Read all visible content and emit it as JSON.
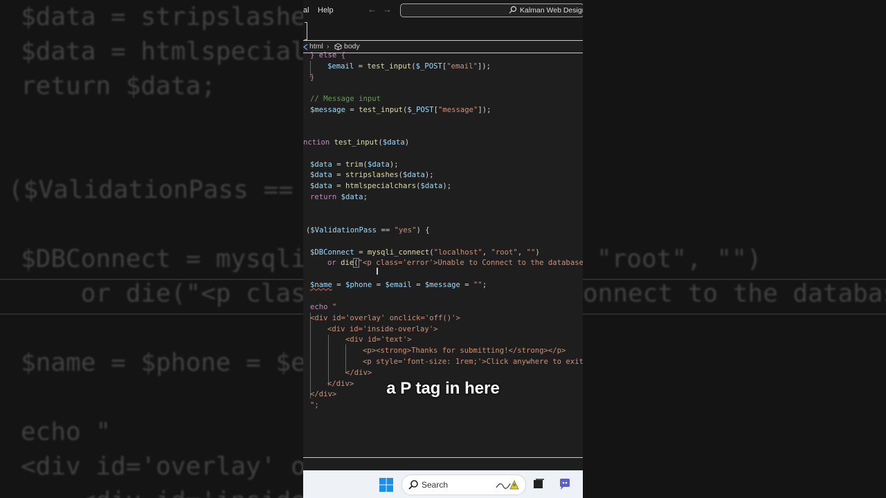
{
  "menu": {
    "partial_item": "al",
    "help": "Help"
  },
  "command_center": {
    "text": "Kalman Web Design I"
  },
  "breadcrumb": {
    "html": "html",
    "body": "body"
  },
  "code_lines": {
    "l1": "} else {",
    "l2a": "$email",
    "l2b": " = ",
    "l2c": "test_input",
    "l2d": "(",
    "l2e": "$_POST",
    "l2f": "[",
    "l2g": "\"email\"",
    "l2h": "]);",
    "l3": "}",
    "l4": "// Message input",
    "l5a": "$message",
    "l5b": " = ",
    "l5c": "test_input",
    "l5d": "(",
    "l5e": "$_POST",
    "l5f": "[",
    "l5g": "\"message\"",
    "l5h": "]);",
    "l6a": "nction",
    "l6b": " test_input",
    "l6c": "(",
    "l6d": "$data",
    "l6e": ")",
    "l7a": "$data",
    "l7b": " = ",
    "l7c": "trim",
    "l7d": "(",
    "l7e": "$data",
    "l7f": ");",
    "l8a": "$data",
    "l8b": " = ",
    "l8c": "stripslashes",
    "l8d": "(",
    "l8e": "$data",
    "l8f": ");",
    "l9a": "$data",
    "l9b": " = ",
    "l9c": "htmlspecialchars",
    "l9d": "(",
    "l9e": "$data",
    "l9f": ");",
    "l10a": "return",
    "l10b": " $data",
    "l10c": ";",
    "l11a": "(",
    "l11b": "$ValidationPass",
    "l11c": " == ",
    "l11d": "\"yes\"",
    "l11e": ") {",
    "l12a": "$DBConnect",
    "l12b": " = ",
    "l12c": "mysqli_connect",
    "l12d": "(",
    "l12e": "\"localhost\"",
    "l12f": ", ",
    "l12g": "\"root\"",
    "l12h": ", ",
    "l12i": "\"\"",
    "l12j": ")",
    "l13a": "or",
    "l13b": " die",
    "l13c": "(",
    "l13d": "\"<p class='error'>Unable to Connect to the database",
    "l14a": "$name",
    "l14b": " = ",
    "l14c": "$phone",
    "l14d": " = ",
    "l14e": "$email",
    "l14f": " = ",
    "l14g": "$message",
    "l14h": " = ",
    "l14i": "\"\"",
    "l14j": ";",
    "l15a": "echo",
    "l15b": " \"",
    "l16": "<div id='overlay' onclick='off()'>",
    "l17": "<div id='inside-overlay'>",
    "l18": "<div id='text'>",
    "l19": "<p><strong>Thanks for submitting!</strong></p>",
    "l20": "<p style='font-size: 1rem;'>Click anywhere to exit",
    "l21": "</div>",
    "l22": "</div>",
    "l23": "</div>",
    "l24": "\";"
  },
  "caption": "a P tag in here",
  "taskbar": {
    "search_label": "Search"
  },
  "background_zoom": {
    "b1": "$data = stripslashes",
    "b2": "$data = htmlspecialc",
    "b3": "return $data;",
    "b4": "($ValidationPass == \"y",
    "b5": "$DBConnect = mysqli_",
    "b5r": "\"root\", \"\")",
    "b6": "    or die(\"<p class",
    "b6r": "onnect to the database",
    "b7": "$name = $phone = $em",
    "b8": "echo \"",
    "b9": "<div id='overlay' on",
    "b10": "    <div id='inside"
  }
}
